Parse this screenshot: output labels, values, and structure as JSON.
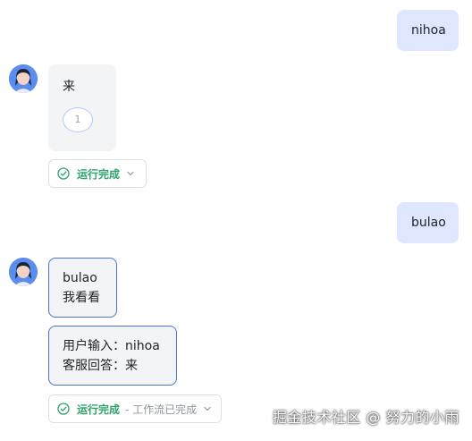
{
  "messages": {
    "user1": "nihoa",
    "bot1": {
      "text": "来",
      "citation": "1"
    },
    "status1": {
      "text": "运行完成"
    },
    "user2": "bulao",
    "bot2": {
      "line1": "bulao",
      "line2": "我看看"
    },
    "bot3": {
      "line1": "用户输入：nihoa",
      "line2": "客服回答：来"
    },
    "status2": {
      "text": "运行完成",
      "extra": "- 工作流已完成"
    }
  },
  "watermark": "掘金技术社区 @ 努力的小雨",
  "colors": {
    "user_bubble": "#dfe6ff",
    "bot_bubble": "#f3f4f6",
    "status_green": "#2ea26b",
    "outline_blue": "#4a72d6"
  }
}
